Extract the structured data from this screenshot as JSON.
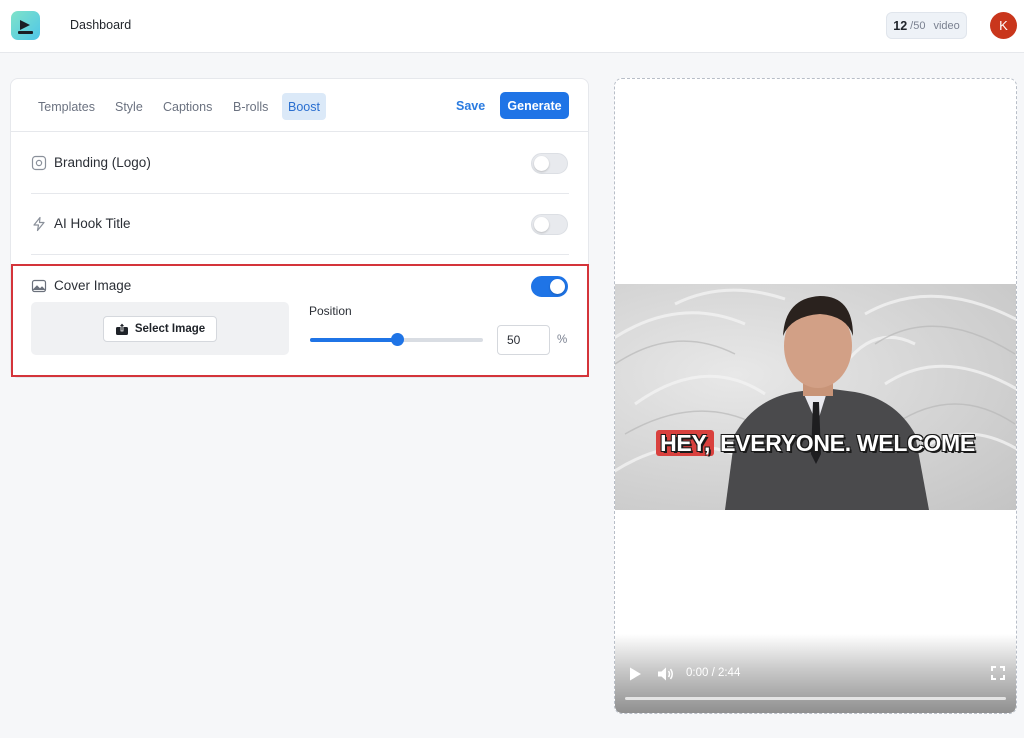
{
  "header": {
    "nav_label": "Dashboard",
    "credits_used": "12",
    "credits_total": "/50",
    "credits_unit": "video",
    "avatar_initial": "K"
  },
  "tabs": [
    {
      "label": "Templates",
      "active": false
    },
    {
      "label": "Style",
      "active": false
    },
    {
      "label": "Captions",
      "active": false
    },
    {
      "label": "B-rolls",
      "active": false
    },
    {
      "label": "Boost",
      "active": true
    }
  ],
  "actions": {
    "save_label": "Save",
    "generate_label": "Generate"
  },
  "settings": {
    "branding": {
      "label": "Branding (Logo)",
      "enabled": false
    },
    "hook_title": {
      "label": "AI Hook Title",
      "enabled": false
    },
    "cover_image": {
      "label": "Cover Image",
      "enabled": true,
      "select_label": "Select Image",
      "position_label": "Position",
      "position_value": "50",
      "position_percent": 50,
      "unit": "%"
    }
  },
  "preview": {
    "caption_highlight": "HEY,",
    "caption_rest": "EVERYONE. WELCOME",
    "time": "0:00 / 2:44"
  },
  "colors": {
    "accent": "#1f74e6",
    "highlight_border": "#d4343a",
    "caption_highlight": "#d9413e"
  }
}
